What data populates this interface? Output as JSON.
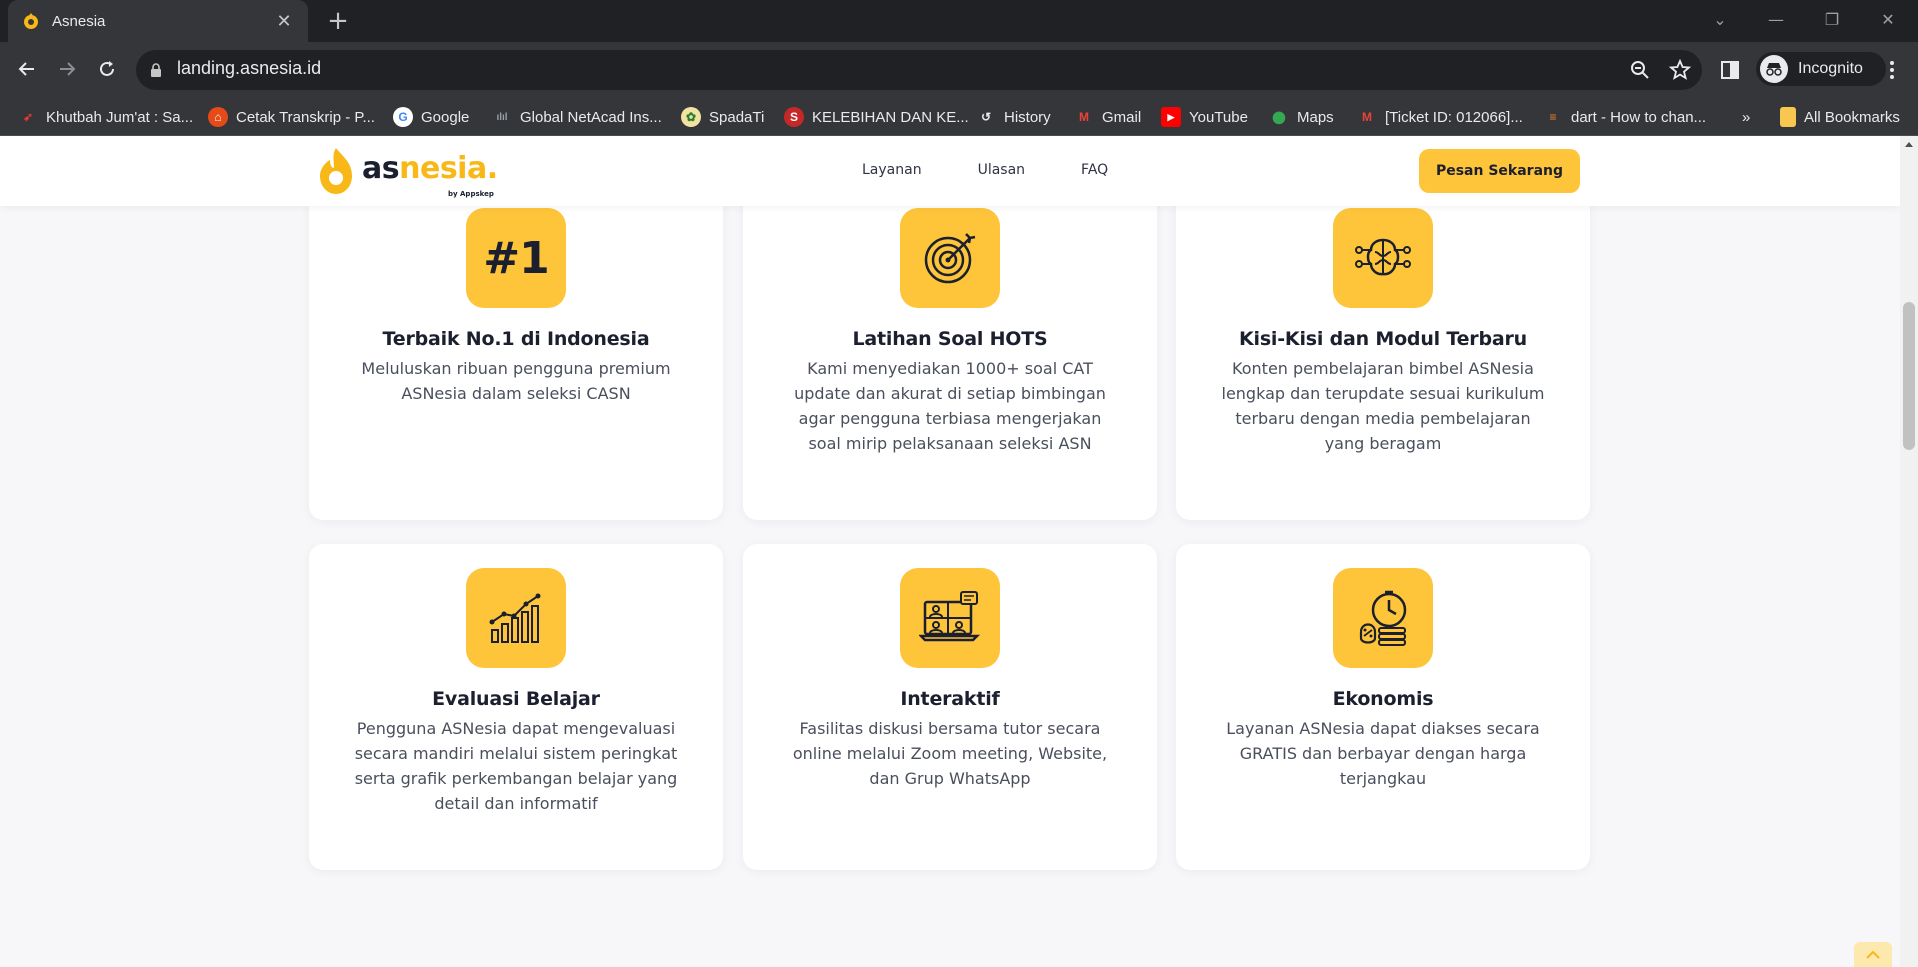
{
  "browser": {
    "tab_title": "Asnesia",
    "url": "landing.asnesia.id",
    "profile_label": "Incognito",
    "bookmarks": [
      {
        "label": "Khutbah Jum'at : Sa...",
        "icon": "red-bird-icon"
      },
      {
        "label": "Cetak Transkrip - P...",
        "icon": "graduation-cap-icon"
      },
      {
        "label": "Google",
        "icon": "google-icon"
      },
      {
        "label": "Global NetAcad Ins...",
        "icon": "cisco-icon"
      },
      {
        "label": "SpadaTi",
        "icon": "spada-logo-icon"
      },
      {
        "label": "KELEBIHAN DAN KE...",
        "icon": "s-logo-icon"
      },
      {
        "label": "History",
        "icon": "history-icon"
      },
      {
        "label": "Gmail",
        "icon": "gmail-icon"
      },
      {
        "label": "YouTube",
        "icon": "youtube-icon"
      },
      {
        "label": "Maps",
        "icon": "maps-pin-icon"
      },
      {
        "label": "[Ticket ID: 012066]...",
        "icon": "gmail-icon"
      },
      {
        "label": "dart - How to chan...",
        "icon": "stackoverflow-icon"
      }
    ],
    "overflow_label": "»",
    "all_bookmarks_label": "All Bookmarks"
  },
  "site": {
    "logo_text_a": "as",
    "logo_text_b": "nesia.",
    "logo_sub": "by Appskep",
    "nav": [
      "Layanan",
      "Ulasan",
      "FAQ"
    ],
    "cta_label": "Pesan Sekarang",
    "accent_color": "#fec53b"
  },
  "features": [
    {
      "icon": "number-one-icon",
      "icon_text": "#1",
      "title": "Terbaik No.1 di Indonesia",
      "desc": "Meluluskan ribuan pengguna premium ASNesia dalam seleksi CASN"
    },
    {
      "icon": "target-icon",
      "title": "Latihan Soal HOTS",
      "desc": "Kami menyediakan 1000+ soal CAT update dan akurat di setiap bimbingan agar pengguna terbiasa mengerjakan soal mirip pelaksanaan seleksi ASN"
    },
    {
      "icon": "brain-circuit-icon",
      "title": "Kisi-Kisi dan Modul Terbaru",
      "desc": "Konten pembelajaran bimbel ASNesia lengkap dan terupdate sesuai kurikulum terbaru dengan media pembelajaran yang beragam"
    },
    {
      "icon": "growth-chart-icon",
      "title": "Evaluasi Belajar",
      "desc": "Pengguna ASNesia dapat mengevaluasi secara mandiri melalui sistem peringkat serta grafik perkembangan belajar yang detail dan informatif"
    },
    {
      "icon": "video-meeting-icon",
      "title": "Interaktif",
      "desc": "Fasilitas diskusi bersama tutor secara online melalui Zoom meeting, Website, dan Grup WhatsApp"
    },
    {
      "icon": "money-time-icon",
      "title": "Ekonomis",
      "desc": "Layanan ASNesia dapat diakses secara GRATIS dan berbayar dengan harga terjangkau"
    }
  ]
}
